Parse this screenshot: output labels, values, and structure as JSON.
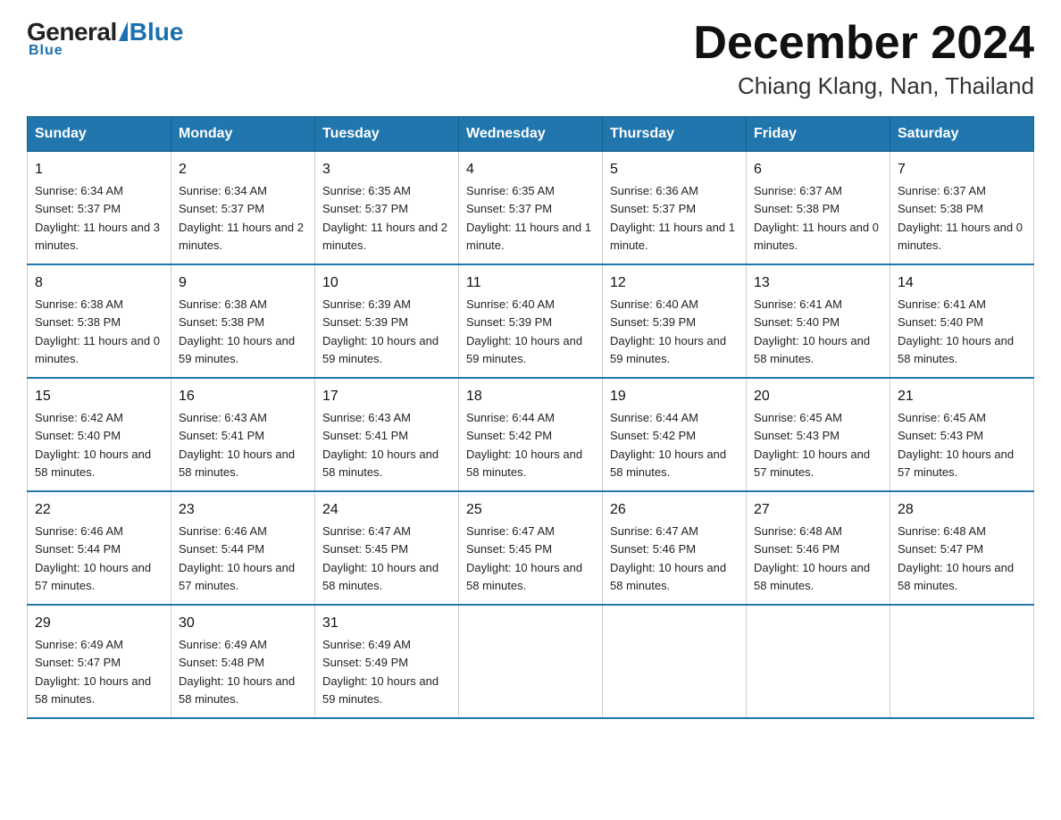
{
  "header": {
    "logo_general": "General",
    "logo_blue": "Blue",
    "month_title": "December 2024",
    "location": "Chiang Klang, Nan, Thailand"
  },
  "days_of_week": [
    "Sunday",
    "Monday",
    "Tuesday",
    "Wednesday",
    "Thursday",
    "Friday",
    "Saturday"
  ],
  "weeks": [
    [
      {
        "day": "1",
        "sunrise": "6:34 AM",
        "sunset": "5:37 PM",
        "daylight": "11 hours and 3 minutes."
      },
      {
        "day": "2",
        "sunrise": "6:34 AM",
        "sunset": "5:37 PM",
        "daylight": "11 hours and 2 minutes."
      },
      {
        "day": "3",
        "sunrise": "6:35 AM",
        "sunset": "5:37 PM",
        "daylight": "11 hours and 2 minutes."
      },
      {
        "day": "4",
        "sunrise": "6:35 AM",
        "sunset": "5:37 PM",
        "daylight": "11 hours and 1 minute."
      },
      {
        "day": "5",
        "sunrise": "6:36 AM",
        "sunset": "5:37 PM",
        "daylight": "11 hours and 1 minute."
      },
      {
        "day": "6",
        "sunrise": "6:37 AM",
        "sunset": "5:38 PM",
        "daylight": "11 hours and 0 minutes."
      },
      {
        "day": "7",
        "sunrise": "6:37 AM",
        "sunset": "5:38 PM",
        "daylight": "11 hours and 0 minutes."
      }
    ],
    [
      {
        "day": "8",
        "sunrise": "6:38 AM",
        "sunset": "5:38 PM",
        "daylight": "11 hours and 0 minutes."
      },
      {
        "day": "9",
        "sunrise": "6:38 AM",
        "sunset": "5:38 PM",
        "daylight": "10 hours and 59 minutes."
      },
      {
        "day": "10",
        "sunrise": "6:39 AM",
        "sunset": "5:39 PM",
        "daylight": "10 hours and 59 minutes."
      },
      {
        "day": "11",
        "sunrise": "6:40 AM",
        "sunset": "5:39 PM",
        "daylight": "10 hours and 59 minutes."
      },
      {
        "day": "12",
        "sunrise": "6:40 AM",
        "sunset": "5:39 PM",
        "daylight": "10 hours and 59 minutes."
      },
      {
        "day": "13",
        "sunrise": "6:41 AM",
        "sunset": "5:40 PM",
        "daylight": "10 hours and 58 minutes."
      },
      {
        "day": "14",
        "sunrise": "6:41 AM",
        "sunset": "5:40 PM",
        "daylight": "10 hours and 58 minutes."
      }
    ],
    [
      {
        "day": "15",
        "sunrise": "6:42 AM",
        "sunset": "5:40 PM",
        "daylight": "10 hours and 58 minutes."
      },
      {
        "day": "16",
        "sunrise": "6:43 AM",
        "sunset": "5:41 PM",
        "daylight": "10 hours and 58 minutes."
      },
      {
        "day": "17",
        "sunrise": "6:43 AM",
        "sunset": "5:41 PM",
        "daylight": "10 hours and 58 minutes."
      },
      {
        "day": "18",
        "sunrise": "6:44 AM",
        "sunset": "5:42 PM",
        "daylight": "10 hours and 58 minutes."
      },
      {
        "day": "19",
        "sunrise": "6:44 AM",
        "sunset": "5:42 PM",
        "daylight": "10 hours and 58 minutes."
      },
      {
        "day": "20",
        "sunrise": "6:45 AM",
        "sunset": "5:43 PM",
        "daylight": "10 hours and 57 minutes."
      },
      {
        "day": "21",
        "sunrise": "6:45 AM",
        "sunset": "5:43 PM",
        "daylight": "10 hours and 57 minutes."
      }
    ],
    [
      {
        "day": "22",
        "sunrise": "6:46 AM",
        "sunset": "5:44 PM",
        "daylight": "10 hours and 57 minutes."
      },
      {
        "day": "23",
        "sunrise": "6:46 AM",
        "sunset": "5:44 PM",
        "daylight": "10 hours and 57 minutes."
      },
      {
        "day": "24",
        "sunrise": "6:47 AM",
        "sunset": "5:45 PM",
        "daylight": "10 hours and 58 minutes."
      },
      {
        "day": "25",
        "sunrise": "6:47 AM",
        "sunset": "5:45 PM",
        "daylight": "10 hours and 58 minutes."
      },
      {
        "day": "26",
        "sunrise": "6:47 AM",
        "sunset": "5:46 PM",
        "daylight": "10 hours and 58 minutes."
      },
      {
        "day": "27",
        "sunrise": "6:48 AM",
        "sunset": "5:46 PM",
        "daylight": "10 hours and 58 minutes."
      },
      {
        "day": "28",
        "sunrise": "6:48 AM",
        "sunset": "5:47 PM",
        "daylight": "10 hours and 58 minutes."
      }
    ],
    [
      {
        "day": "29",
        "sunrise": "6:49 AM",
        "sunset": "5:47 PM",
        "daylight": "10 hours and 58 minutes."
      },
      {
        "day": "30",
        "sunrise": "6:49 AM",
        "sunset": "5:48 PM",
        "daylight": "10 hours and 58 minutes."
      },
      {
        "day": "31",
        "sunrise": "6:49 AM",
        "sunset": "5:49 PM",
        "daylight": "10 hours and 59 minutes."
      },
      null,
      null,
      null,
      null
    ]
  ]
}
